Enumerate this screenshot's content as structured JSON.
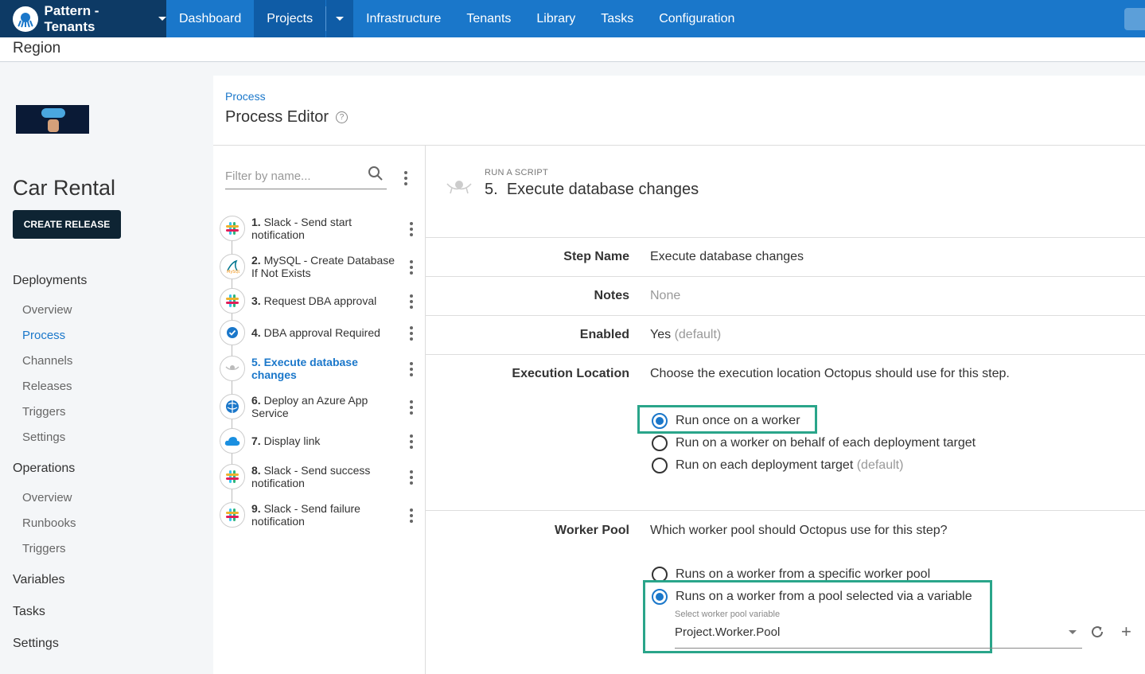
{
  "topnav": {
    "space_name": "Pattern - Tenants",
    "items": [
      "Dashboard",
      "Projects",
      "Infrastructure",
      "Tenants",
      "Library",
      "Tasks",
      "Configuration"
    ],
    "active": "Projects"
  },
  "header": {
    "region": "Region"
  },
  "sidebar": {
    "project_name": "Car Rental",
    "create_release": "CREATE RELEASE",
    "deployments": "Deployments",
    "deployments_items": [
      "Overview",
      "Process",
      "Channels",
      "Releases",
      "Triggers",
      "Settings"
    ],
    "active_item": "Process",
    "operations": "Operations",
    "operations_items": [
      "Overview",
      "Runbooks",
      "Triggers"
    ],
    "variables": "Variables",
    "tasks": "Tasks",
    "settings": "Settings"
  },
  "main": {
    "breadcrumb": "Process",
    "title": "Process Editor",
    "filter_placeholder": "Filter by name...",
    "steps": [
      {
        "num": "1.",
        "name": "Slack - Send start notification",
        "icon": "slack-icon"
      },
      {
        "num": "2.",
        "name": "MySQL - Create Database If Not Exists",
        "icon": "mysql-icon"
      },
      {
        "num": "3.",
        "name": "Request DBA approval",
        "icon": "slack-icon"
      },
      {
        "num": "4.",
        "name": "DBA approval Required",
        "icon": "check-circle-icon"
      },
      {
        "num": "5.",
        "name": "Execute database changes",
        "icon": "octopus-icon",
        "active": true
      },
      {
        "num": "6.",
        "name": "Deploy an Azure App Service",
        "icon": "azure-web-icon"
      },
      {
        "num": "7.",
        "name": "Display link",
        "icon": "azure-cloud-icon"
      },
      {
        "num": "8.",
        "name": "Slack - Send success notification",
        "icon": "slack-icon"
      },
      {
        "num": "9.",
        "name": "Slack - Send failure notification",
        "icon": "slack-icon"
      }
    ]
  },
  "detail": {
    "kind": "RUN A SCRIPT",
    "heading_num": "5.",
    "heading": "Execute database changes",
    "step_name_label": "Step Name",
    "step_name_value": "Execute database changes",
    "notes_label": "Notes",
    "notes_value": "None",
    "enabled_label": "Enabled",
    "enabled_value": "Yes",
    "enabled_default": "(default)",
    "exec_label": "Execution Location",
    "exec_desc": "Choose the execution location Octopus should use for this step.",
    "exec_options": [
      "Run once on a worker",
      "Run on a worker on behalf of each deployment target",
      "Run on each deployment target"
    ],
    "exec_default_suffix": "(default)",
    "worker_pool_label": "Worker Pool",
    "worker_pool_desc": "Which worker pool should Octopus use for this step?",
    "pool_options": [
      "Runs on a worker from a specific worker pool",
      "Runs on a worker from a pool selected via a variable"
    ],
    "var_label": "Select worker pool variable",
    "var_value": "Project.Worker.Pool"
  }
}
